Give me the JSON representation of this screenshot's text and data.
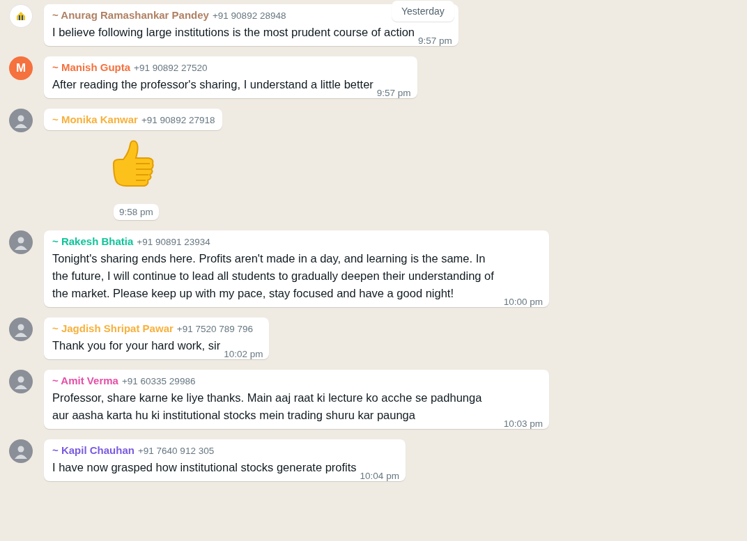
{
  "date_chip": "Yesterday",
  "messages": [
    {
      "kind": "text",
      "avatar": {
        "kind": "logo"
      },
      "sender": "~ Anurag Ramashankar Pandey",
      "color": "#b08164",
      "phone": "+91 90892 28948",
      "text": "I believe following large institutions is the most prudent course of action",
      "time": "9:57 pm"
    },
    {
      "kind": "text",
      "avatar": {
        "kind": "letter",
        "letter": "M",
        "color": "#f5713d"
      },
      "sender": "~ Manish Gupta",
      "color": "#f5713d",
      "phone": "+91 90892 27520",
      "text": "After reading the professor's sharing, I understand a little better",
      "time": "9:57 pm"
    },
    {
      "kind": "sticker",
      "avatar": {
        "kind": "photo"
      },
      "sender": "~ Monika Kanwar",
      "color": "#f7b13c",
      "phone": "+91 90892 27918",
      "time": "9:58 pm"
    },
    {
      "kind": "text",
      "avatar": {
        "kind": "photo"
      },
      "sender": "~ Rakesh Bhatia",
      "color": "#10c49a",
      "phone": "+91 90891 23934",
      "text": "Tonight's sharing ends here. Profits aren't made in a day, and learning is the same. In the future, I will continue to lead all students to gradually deepen their understanding of the market. Please keep up with my pace, stay focused and have a good night!",
      "time": "10:00 pm"
    },
    {
      "kind": "text",
      "avatar": {
        "kind": "photo"
      },
      "sender": "~ Jagdish Shripat Pawar",
      "color": "#f7b13c",
      "phone": "+91 7520 789 796",
      "text": "Thank you for your hard work, sir",
      "time": "10:02 pm"
    },
    {
      "kind": "text",
      "avatar": {
        "kind": "photo"
      },
      "sender": "~ Amit Verma",
      "color": "#e54fa6",
      "phone": "+91 60335 29986",
      "text": "Professor, share karne ke liye thanks. Main aaj raat ki lecture ko acche se padhunga aur aasha karta hu ki institutional stocks mein trading shuru kar paunga",
      "time": "10:03 pm"
    },
    {
      "kind": "text",
      "avatar": {
        "kind": "photo"
      },
      "sender": "~ Kapil Chauhan",
      "color": "#7a5be0",
      "phone": "+91 7640 912 305",
      "text": "I have now grasped how institutional stocks generate profits",
      "time": "10:04 pm"
    }
  ]
}
